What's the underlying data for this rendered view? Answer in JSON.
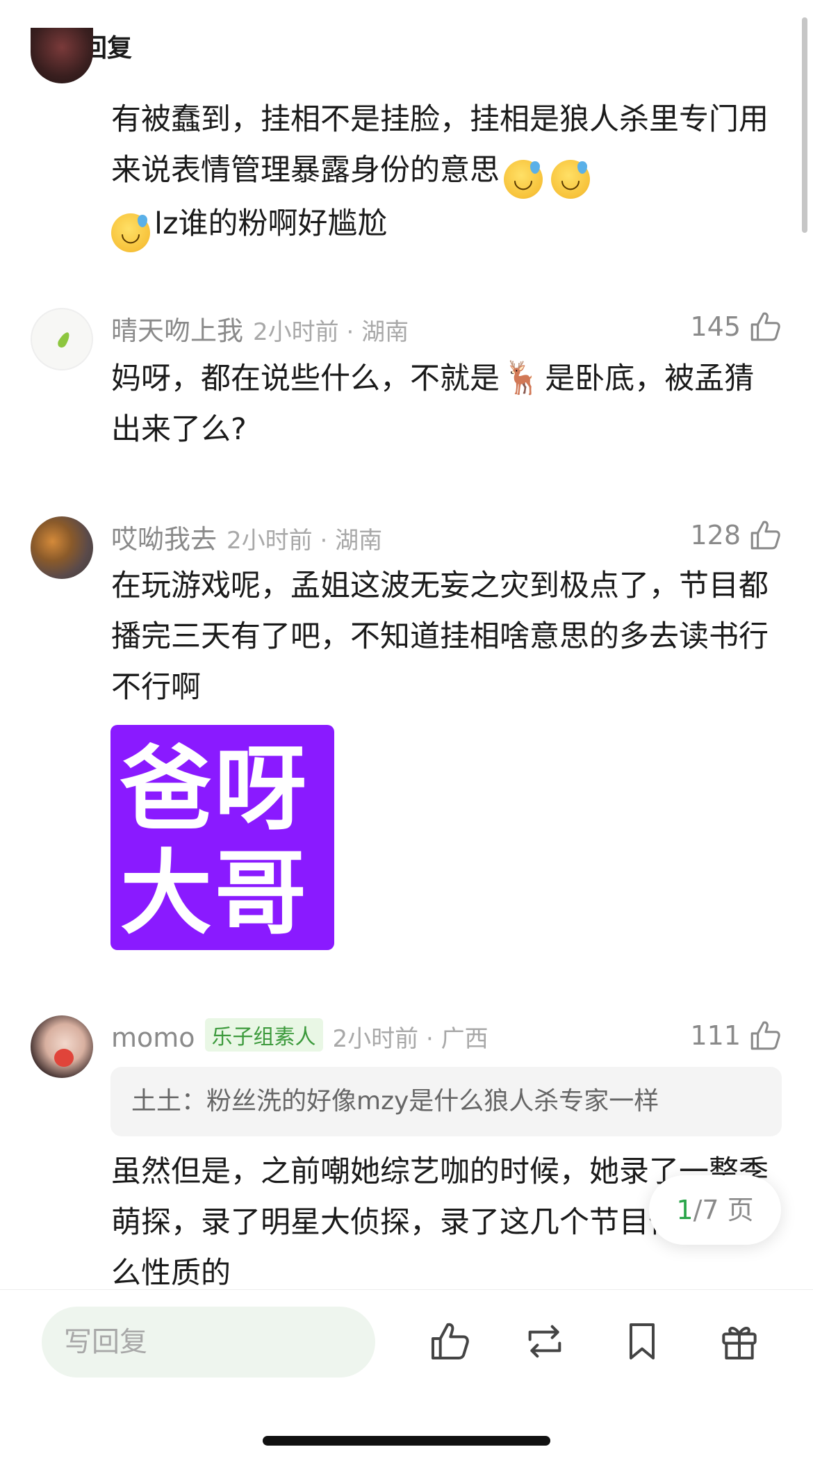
{
  "header": {
    "title": "热门回复"
  },
  "comments": [
    {
      "text_a": "有被蠢到，挂相不是挂脸，挂相是狼人杀里专门用来说表情管理暴露身份的意思",
      "text_b": "lz谁的粉啊好尴尬",
      "emoji_icon": "sweat-smile-emoji"
    },
    {
      "user": "晴天吻上我",
      "meta": "2小时前 · 湖南",
      "likes": "145",
      "text_a": "妈呀，都在说些什么，不就是",
      "text_b": "是卧底，被孟猜出来了么?",
      "emoji_icon": "deer-emoji"
    },
    {
      "user": "哎呦我去",
      "meta": "2小时前 · 湖南",
      "likes": "128",
      "text": "在玩游戏呢，孟姐这波无妄之灾到极点了，节目都播完三天有了吧，不知道挂相啥意思的多去读书行不行啊",
      "sticker": {
        "line1": "爸呀",
        "line2": "大哥",
        "color": "#8a1aff"
      }
    },
    {
      "user": "momo",
      "badge": "乐子组素人",
      "meta": "2小时前 · 广西",
      "likes": "111",
      "quote": "土土：粉丝洗的好像mzy是什么狼人杀专家一样",
      "text": "虽然但是，之前嘲她综艺咖的时候，她录了一整季萌探，录了明星大侦探，录了这几个节目你猜是什么性质的"
    }
  ],
  "pager": {
    "current": "1",
    "total": "/7 页"
  },
  "bottom_bar": {
    "reply_placeholder": "写回复",
    "icons": [
      "thumbs-up-icon",
      "repost-icon",
      "bookmark-icon",
      "gift-icon"
    ]
  },
  "colors": {
    "accent_green": "#2aa54a",
    "sticker_purple": "#8a1aff",
    "badge_green": "#3c9a3c"
  }
}
